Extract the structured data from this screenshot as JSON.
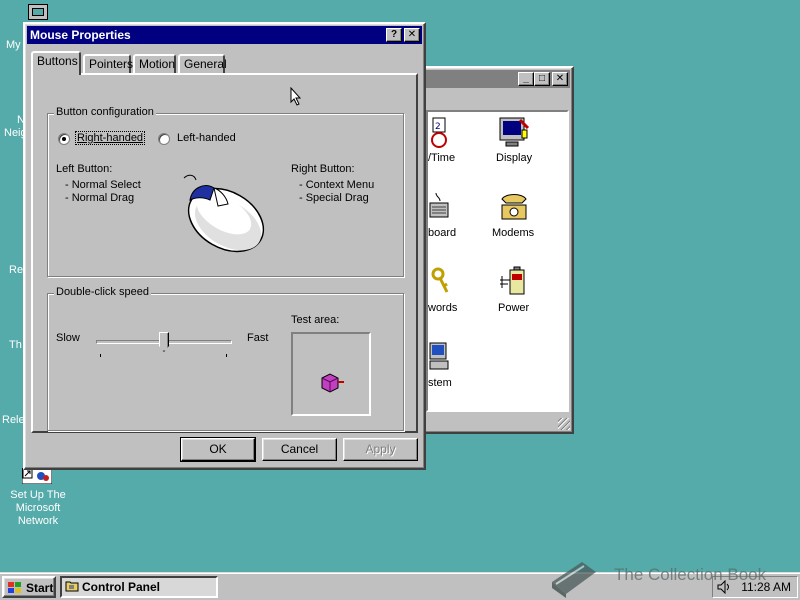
{
  "desktop": {
    "label_fragments": [
      "My",
      "N",
      "Neig",
      "Re",
      "Th",
      "Rele"
    ],
    "setup_network_label": "Set Up The Microsoft Network"
  },
  "control_panel": {
    "items": [
      {
        "label": "/Time",
        "icon": "date-time-icon"
      },
      {
        "label": "Display",
        "icon": "display-icon"
      },
      {
        "label": "board",
        "icon": "keyboard-icon"
      },
      {
        "label": "Modems",
        "icon": "modem-phone-icon"
      },
      {
        "label": "words",
        "icon": "passwords-keys-icon"
      },
      {
        "label": "Power",
        "icon": "power-battery-icon"
      },
      {
        "label": "stem",
        "icon": "system-computer-icon"
      }
    ]
  },
  "dialog": {
    "title": "Mouse Properties",
    "help_button": "?",
    "close_button": "✕",
    "tabs": [
      "Buttons",
      "Pointers",
      "Motion",
      "General"
    ],
    "active_tab": "Buttons",
    "button_config": {
      "title": "Button configuration",
      "right_handed": "Right-handed",
      "left_handed": "Left-handed",
      "selected": "Right-handed",
      "left_button_heading": "Left Button:",
      "left_button_items": [
        "-  Normal Select",
        "-  Normal Drag"
      ],
      "right_button_heading": "Right Button:",
      "right_button_items": [
        "-  Context Menu",
        "-  Special Drag"
      ]
    },
    "double_click": {
      "title": "Double-click speed",
      "slow": "Slow",
      "fast": "Fast",
      "speed_fraction": 0.5,
      "test_area_label": "Test area:"
    },
    "buttons": {
      "ok": "OK",
      "cancel": "Cancel",
      "apply": "Apply"
    }
  },
  "taskbar": {
    "start_label": "Start",
    "task_label": "Control Panel",
    "clock": "11:28 AM"
  },
  "watermark": {
    "text": "The Collection Book"
  },
  "colors": {
    "desktop": "#55aaaa",
    "titlebar_active": "#000080",
    "face": "#c0c0c0"
  }
}
